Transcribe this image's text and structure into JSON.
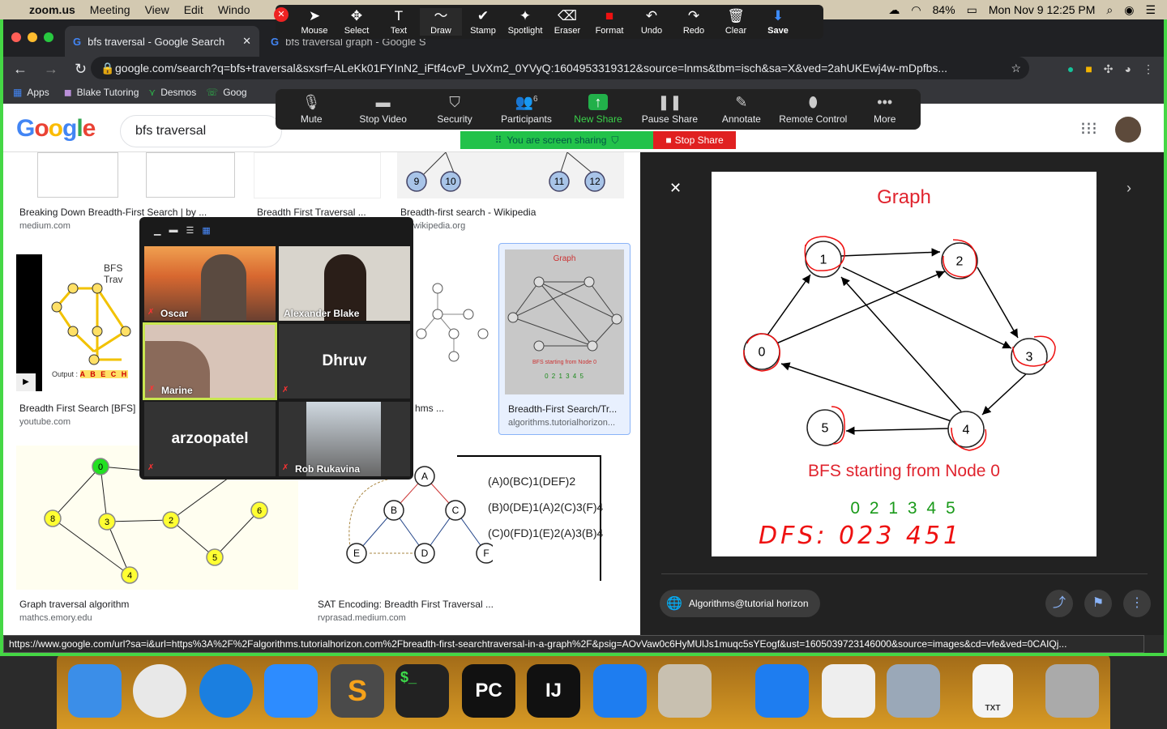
{
  "menubar": {
    "app": "zoom.us",
    "items": [
      "Meeting",
      "View",
      "Edit",
      "Windo"
    ],
    "battery": "84%",
    "datetime": "Mon Nov 9  12:25 PM"
  },
  "annotate": {
    "tools": [
      {
        "label": "Mouse",
        "icon": "mouse-pointer-icon",
        "glyph": "➤"
      },
      {
        "label": "Select",
        "icon": "move-icon",
        "glyph": "✥"
      },
      {
        "label": "Text",
        "icon": "text-icon",
        "glyph": "T"
      },
      {
        "label": "Draw",
        "icon": "draw-icon",
        "glyph": "〜"
      },
      {
        "label": "Stamp",
        "icon": "check-icon",
        "glyph": "✔"
      },
      {
        "label": "Spotlight",
        "icon": "spotlight-icon",
        "glyph": "✦"
      },
      {
        "label": "Eraser",
        "icon": "eraser-icon",
        "glyph": "⌫"
      },
      {
        "label": "Format",
        "icon": "format-icon",
        "glyph": "■"
      },
      {
        "label": "Undo",
        "icon": "undo-icon",
        "glyph": "↶"
      },
      {
        "label": "Redo",
        "icon": "redo-icon",
        "glyph": "↷"
      },
      {
        "label": "Clear",
        "icon": "trash-icon",
        "glyph": "🗑"
      },
      {
        "label": "Save",
        "icon": "save-icon",
        "glyph": "⬇"
      }
    ]
  },
  "browser": {
    "tabs": [
      {
        "title": "bfs traversal - Google Search"
      },
      {
        "title": "bfs traversal graph - Google S"
      }
    ],
    "url": "google.com/search?q=bfs+traversal&sxsrf=ALeKk01FYInN2_iFtf4cvP_UvXm2_0YVyQ:1604953319312&source=lnms&tbm=isch&sa=X&ved=2ahUKEwj4w-mDpfbs...",
    "bookmarks": [
      "Apps",
      "Blake Tutoring",
      "Desmos",
      "Goog"
    ]
  },
  "zoom": {
    "toolbar": [
      "Mute",
      "Stop Video",
      "Security",
      "Participants",
      "New Share",
      "Pause Share",
      "Annotate",
      "Remote Control",
      "More"
    ],
    "participants_count": "6",
    "sharing_text": "You are screen sharing",
    "stop_share": "Stop Share"
  },
  "google": {
    "logo": "Google",
    "query": "bfs traversal"
  },
  "results": [
    {
      "title": "Breaking Down Breadth-First Search | by ...",
      "source": "medium.com"
    },
    {
      "title": "Breadth First Traversal ...",
      "source": ""
    },
    {
      "title": "Breadth-first search - Wikipedia",
      "source": "wikipedia.org"
    },
    {
      "title": "Breadth First Search [BFS]",
      "source": "youtube.com"
    },
    {
      "title": "hms ...",
      "source": ""
    },
    {
      "title": "Breadth-First Search/Tr...",
      "source": "algorithms.tutorialhorizon..."
    },
    {
      "title": "Graph traversal algorithm",
      "source": "mathcs.emory.edu"
    },
    {
      "title": "SAT Encoding: Breadth First Traversal ...",
      "source": "rvprasad.medium.com"
    }
  ],
  "thumb_text": {
    "bfs_title": "BFS Trav",
    "output_label": "Output :",
    "output_seq": "A B E C H",
    "tree_nodes": [
      "9",
      "10",
      "11",
      "12"
    ],
    "small_graph_title": "Graph",
    "small_graph_caption": "BFS starting from Node 0",
    "small_graph_seq": "0 2 1 3 4 5",
    "sat_lines": [
      "(A)0(BC)1(DEF)2",
      "(B)0(DE)1(A)2(C)3(F)4",
      "(C)0(FD)1(E)2(A)3(B)4"
    ],
    "sat_nodes": [
      "A",
      "B",
      "C",
      "D",
      "E",
      "F"
    ],
    "emory_nodes": [
      "0",
      "8",
      "3",
      "2",
      "6",
      "5",
      "4"
    ]
  },
  "gallery": {
    "participants": [
      "Oscar",
      "Alexander Blake",
      "Marine",
      "Dhruv",
      "arzoopatel",
      "Rob Rukavina"
    ]
  },
  "preview": {
    "graph_title": "Graph",
    "caption": "BFS starting from Node 0",
    "sequence": "0 2 1 3 4 5",
    "handwritten": "DFS:  023 451",
    "nodes": [
      "0",
      "1",
      "2",
      "3",
      "4",
      "5"
    ],
    "source_chip": "Algorithms@tutorial horizon"
  },
  "status_url": "https://www.google.com/url?sa=i&url=https%3A%2F%2Falgorithms.tutorialhorizon.com%2Fbreadth-first-searchtraversal-in-a-graph%2F&psig=AOvVaw0c6HyMUlJs1muqc5sYEogf&ust=1605039723146000&source=images&cd=vfe&ved=0CAIQj...",
  "dock": [
    {
      "name": "finder-icon",
      "label": "",
      "color": "#3b8ee8"
    },
    {
      "name": "chrome-icon",
      "label": "",
      "color": "#e8e8e8"
    },
    {
      "name": "safari-icon",
      "label": "",
      "color": "#1b7fe0"
    },
    {
      "name": "zoom-icon",
      "label": "",
      "color": "#2d8cff"
    },
    {
      "name": "sublime-icon",
      "label": "S",
      "color": "#4a4a4a"
    },
    {
      "name": "terminal-icon",
      "label": "$_",
      "color": "#222"
    },
    {
      "name": "pycharm-icon",
      "label": "PC",
      "color": "#111"
    },
    {
      "name": "intellij-icon",
      "label": "IJ",
      "color": "#111"
    },
    {
      "name": "xcode-icon",
      "label": "",
      "color": "#1e7df0"
    },
    {
      "name": "calculator-icon",
      "label": "",
      "color": "#c8c0b0"
    },
    {
      "name": "xcode-icon-2",
      "label": "",
      "color": "#1e7df0"
    },
    {
      "name": "textedit-icon",
      "label": "",
      "color": "#eeeeee"
    },
    {
      "name": "preview-icon",
      "label": "",
      "color": "#9aa8b8"
    },
    {
      "name": "txt-file-icon",
      "label": "TXT",
      "color": "#f4f4f4"
    },
    {
      "name": "trash-icon",
      "label": "",
      "color": "#aaaaaa"
    }
  ],
  "colors": {
    "zoom_green": "#45d745",
    "graph_red": "#e0242e",
    "seq_green": "#1a9a1a",
    "annot_red": "#e11"
  }
}
